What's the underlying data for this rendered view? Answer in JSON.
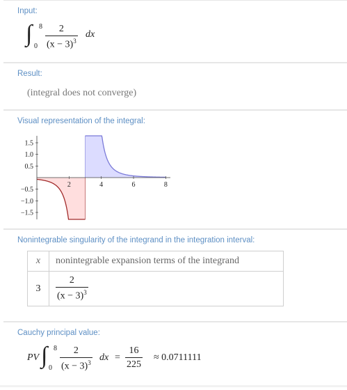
{
  "input": {
    "title": "Input:",
    "upper": "8",
    "lower": "0",
    "numerator": "2",
    "denominator": "(x − 3)",
    "exponent": "3",
    "differential": "dx"
  },
  "result": {
    "title": "Result:",
    "text": "(integral does not converge)"
  },
  "visual": {
    "title": "Visual representation of the integral:",
    "colors": {
      "positive_fill": "#dcdcff",
      "negative_fill": "#ffdede",
      "positive_line": "#7a7ad8",
      "negative_line": "#a12a2a",
      "axis": "#444444"
    },
    "chart_data": {
      "type": "area",
      "function": "2/(x-3)^3",
      "xlim": [
        0,
        8.2
      ],
      "ylim": [
        -1.8,
        1.8
      ],
      "singularity": 3,
      "x_ticks": [
        "2",
        "4",
        "6",
        "8"
      ],
      "y_ticks": [
        "1.5",
        "1.0",
        "0.5",
        "−0.5",
        "−1.0",
        "−1.5"
      ],
      "y_tick_values": [
        1.5,
        1.0,
        0.5,
        -0.5,
        -1.0,
        -1.5
      ],
      "x_tick_values": [
        2,
        4,
        6,
        8
      ],
      "grid": false
    }
  },
  "singularity": {
    "title": "Nonintegrable singularity of the integrand in the integration interval:",
    "col_x": "x",
    "col_terms": "nonintegrable expansion terms of the integrand",
    "row_x": "3",
    "row_num": "2",
    "row_den": "(x − 3)",
    "row_exp": "3"
  },
  "cauchy": {
    "title": "Cauchy principal value:",
    "pv": "PV",
    "upper": "8",
    "lower": "0",
    "numerator": "2",
    "denominator": "(x − 3)",
    "exponent": "3",
    "differential": "dx",
    "equals": "=",
    "result_num": "16",
    "result_den": "225",
    "approx": "≈ 0.0711111"
  }
}
